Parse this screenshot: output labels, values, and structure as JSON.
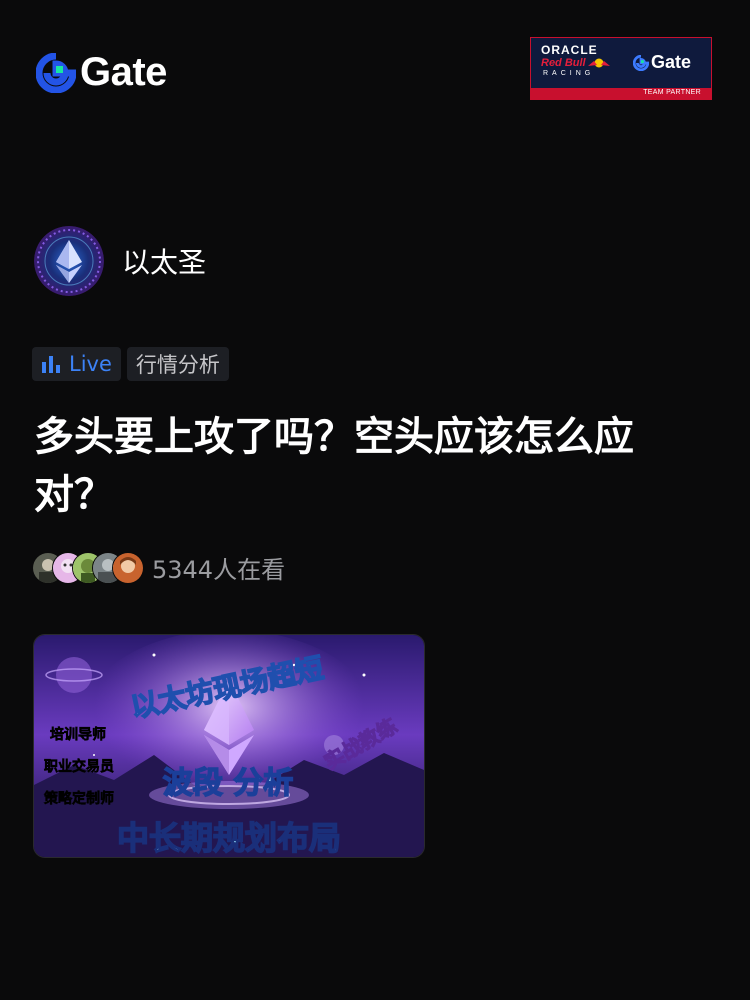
{
  "header": {
    "logo_text": "Gate",
    "logo_icon": "gate-logo-icon",
    "partner_badge": {
      "line1": "ORACLE",
      "line2": "Red Bull",
      "line3": "RACING",
      "brand": "Gate",
      "caption": "TEAM PARTNER"
    }
  },
  "channel": {
    "name": "以太圣",
    "avatar_icon": "ethereum-avatar"
  },
  "tags": {
    "live_label": "Live",
    "category_label": "行情分析"
  },
  "title": "多头要上攻了吗？空头应该怎么应对？",
  "viewers": {
    "count_text": "5344人在看"
  },
  "cover": {
    "headline": "以太坊现场超短",
    "side_labels": [
      "培训导师",
      "职业交易员",
      "策略定制师"
    ],
    "middle_text": "波段 分析",
    "coach_text": "实战教练",
    "bottom_text": "中长期规划布局"
  },
  "colors": {
    "background": "#0a0a0b",
    "accent_blue": "#3c82f6",
    "gate_teal": "#17e6a1",
    "gate_blue": "#2354e6",
    "muted_text": "#9b9ca0"
  }
}
